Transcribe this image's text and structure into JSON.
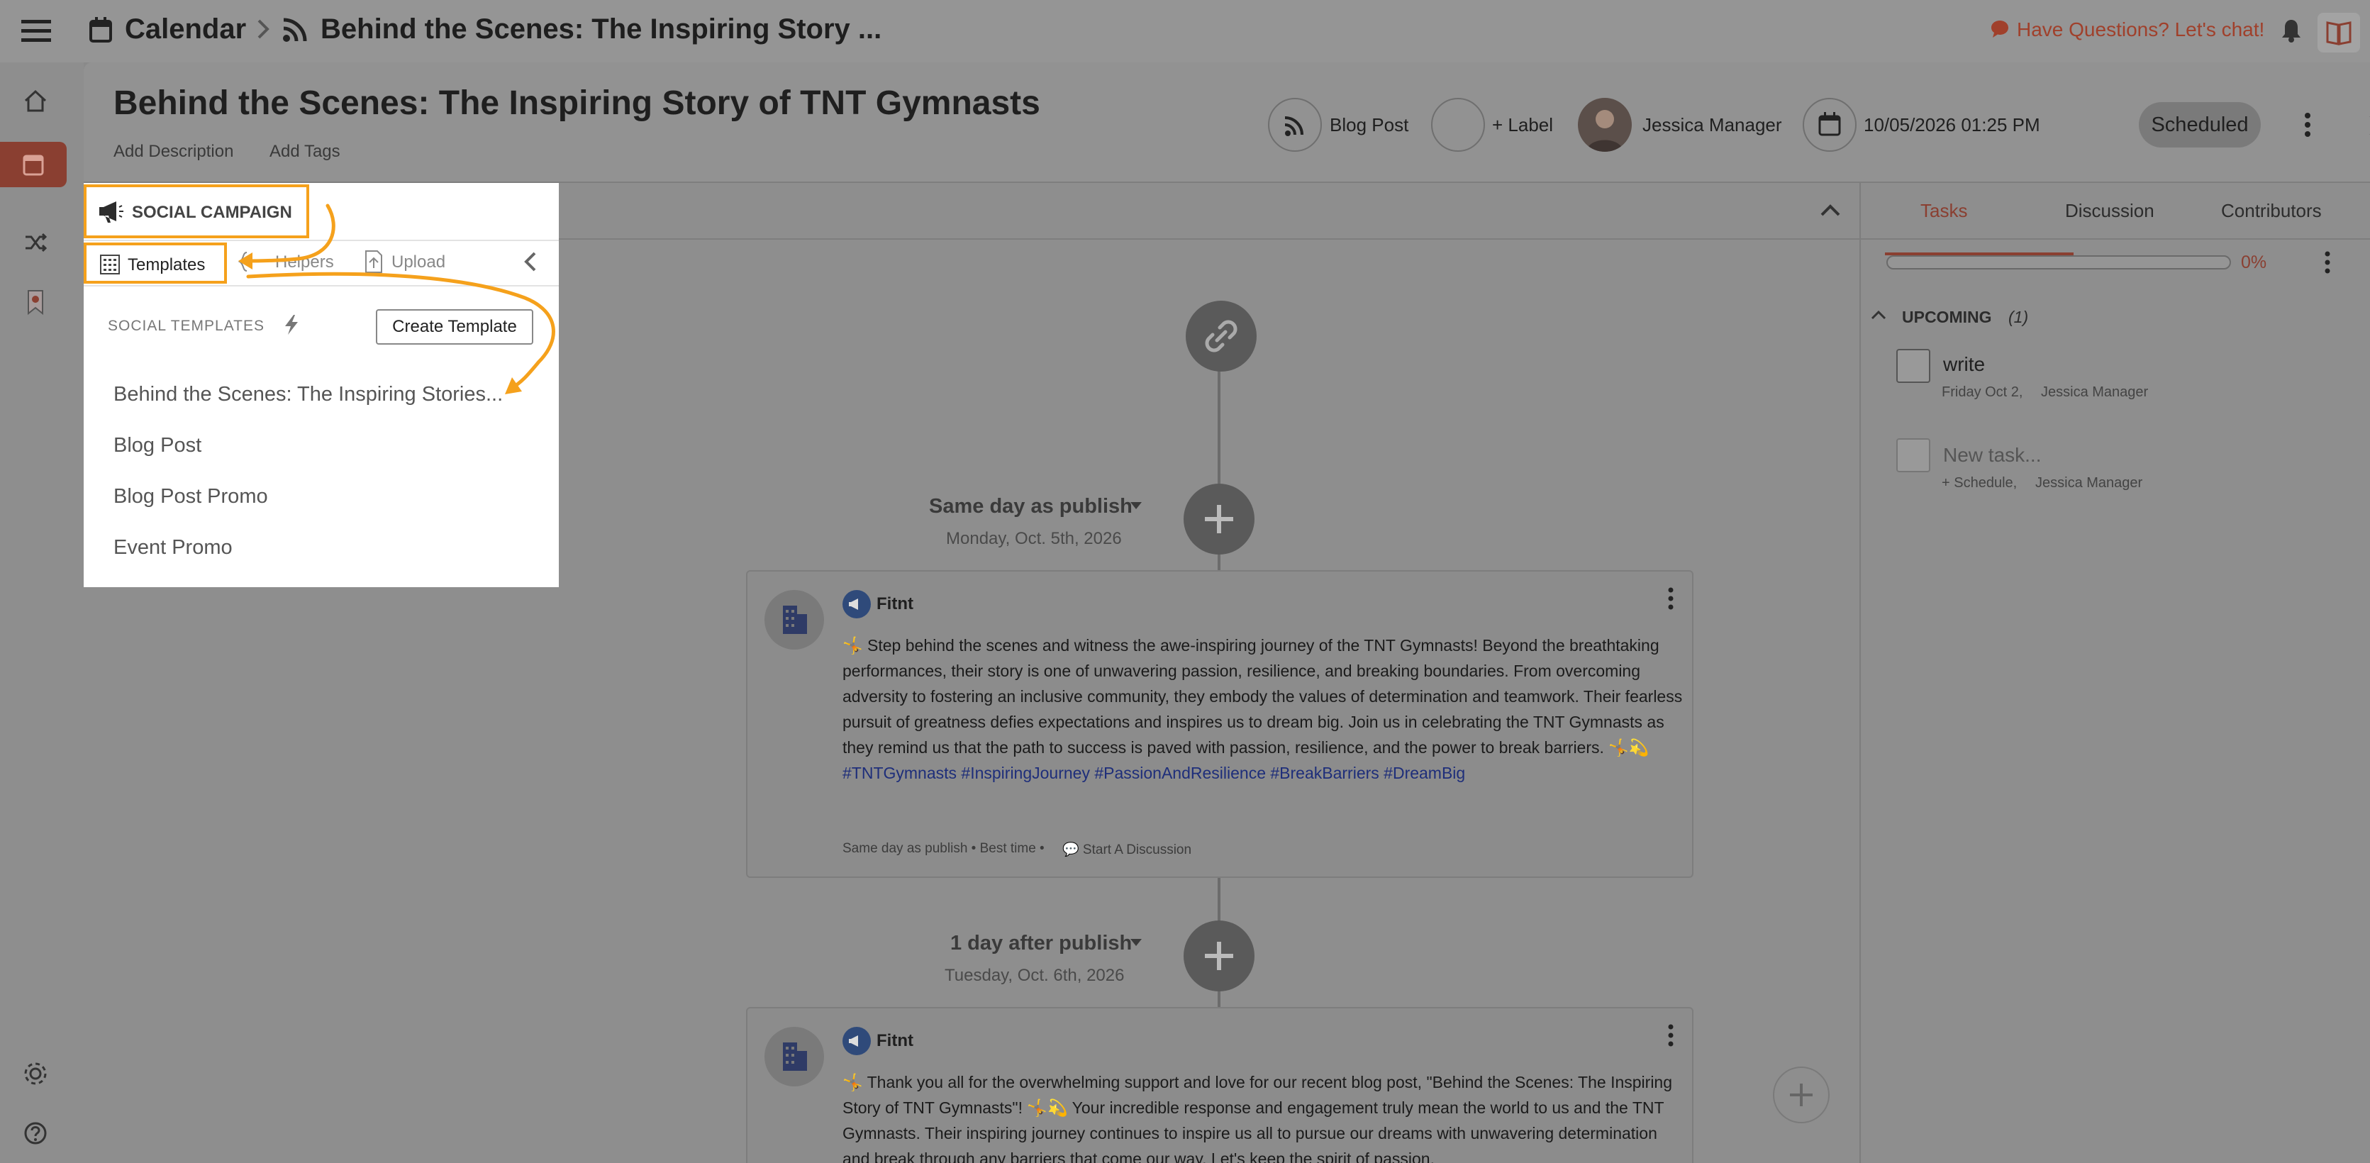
{
  "breadcrumb": {
    "root": "Calendar",
    "current": "Behind the Scenes: The Inspiring Story ..."
  },
  "topbar": {
    "chat_label": "Have Questions? Let's chat!"
  },
  "header": {
    "title": "Behind the Scenes: The Inspiring Story of TNT Gymnasts",
    "add_description": "Add Description",
    "add_tags": "Add Tags",
    "content_type": "Blog Post",
    "label": "+ Label",
    "owner": "Jessica Manager",
    "datetime": "10/05/2026 01:25 PM",
    "status": "Scheduled"
  },
  "social_panel": {
    "heading": "SOCIAL CAMPAIGN",
    "tabs": [
      "Templates",
      "Helpers",
      "Upload"
    ],
    "section_title": "SOCIAL TEMPLATES",
    "create_button": "Create Template",
    "templates": [
      "Behind the Scenes: The Inspiring Stories...",
      "Blog Post",
      "Blog Post Promo",
      "Event Promo"
    ]
  },
  "feed": {
    "groups": [
      {
        "heading": "Same day as publish",
        "date": "Monday, Oct. 5th, 2026",
        "account": "Fitnt",
        "text": "🤸 Step behind the scenes and witness the awe-inspiring journey of the TNT Gymnasts! Beyond the breathtaking performances, their story is one of unwavering passion, resilience, and breaking boundaries. From overcoming adversity to fostering an inclusive community, they embody the values of determination and teamwork. Their fearless pursuit of greatness defies expectations and inspires us to dream big. Join us in celebrating the TNT Gymnasts as they remind us that the path to success is paved with passion, resilience, and the power to break barriers. 🤸💫",
        "hashtags": "#TNTGymnasts #InspiringJourney #PassionAndResilience #BreakBarriers #DreamBig",
        "meta": "Same day as publish • Best time •",
        "discussion": "💬 Start A Discussion"
      },
      {
        "heading": "1 day after publish",
        "date": "Tuesday, Oct. 6th, 2026",
        "account": "Fitnt",
        "text": "🤸 Thank you all for the overwhelming support and love for our recent blog post, \"Behind the Scenes: The Inspiring Story of TNT Gymnasts\"! 🤸💫 Your incredible response and engagement truly mean the world to us and the TNT Gymnasts. Their inspiring journey continues to inspire us all to pursue our dreams with unwavering determination and break through any barriers that come our way. Let's keep the spirit of passion,"
      }
    ]
  },
  "right_panel": {
    "tabs": [
      "Tasks",
      "Discussion",
      "Contributors"
    ],
    "progress": "0%",
    "progress_value": 0,
    "upcoming_label": "UPCOMING",
    "upcoming_count": "(1)",
    "tasks": [
      {
        "title": "write",
        "meta_date": "Friday Oct 2,",
        "meta_user": "Jessica Manager"
      }
    ],
    "new_task": {
      "placeholder": "New task...",
      "meta_date": "+ Schedule,",
      "meta_user": "Jessica Manager"
    }
  },
  "colors": {
    "accent": "#a0402b",
    "highlight": "#f5a11c",
    "hashtag": "#1e2e7a"
  }
}
